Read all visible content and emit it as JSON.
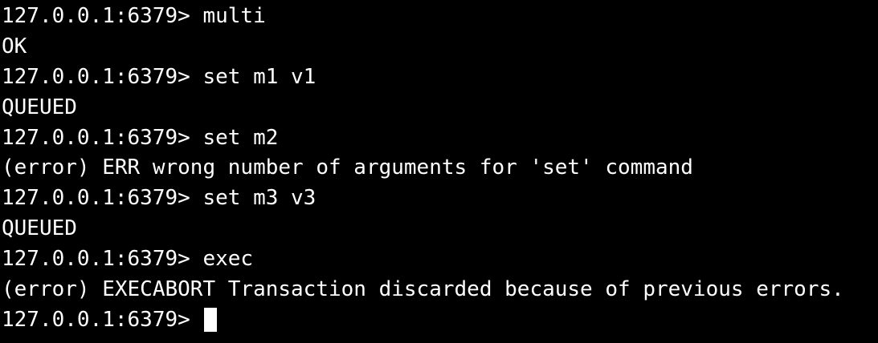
{
  "theme": {
    "background": "#000000",
    "foreground": "#ffffff"
  },
  "terminal": {
    "lines": [
      {
        "type": "prompt",
        "prompt": "127.0.0.1:6379> ",
        "command": "multi"
      },
      {
        "type": "output",
        "text": "OK"
      },
      {
        "type": "prompt",
        "prompt": "127.0.0.1:6379> ",
        "command": "set m1 v1"
      },
      {
        "type": "output",
        "text": "QUEUED"
      },
      {
        "type": "prompt",
        "prompt": "127.0.0.1:6379> ",
        "command": "set m2"
      },
      {
        "type": "output",
        "text": "(error) ERR wrong number of arguments for 'set' command"
      },
      {
        "type": "prompt",
        "prompt": "127.0.0.1:6379> ",
        "command": "set m3 v3"
      },
      {
        "type": "output",
        "text": "QUEUED"
      },
      {
        "type": "prompt",
        "prompt": "127.0.0.1:6379> ",
        "command": "exec"
      },
      {
        "type": "output",
        "text": "(error) EXECABORT Transaction discarded because of previous errors."
      },
      {
        "type": "prompt",
        "prompt": "127.0.0.1:6379> ",
        "command": ""
      }
    ]
  }
}
